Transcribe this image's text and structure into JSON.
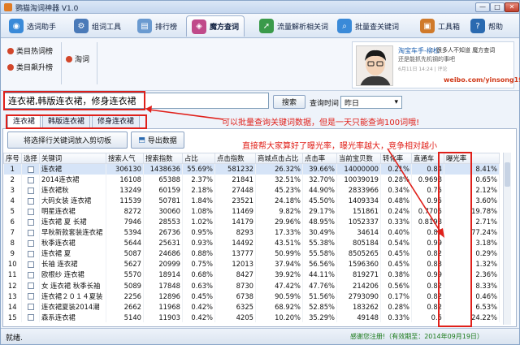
{
  "window": {
    "title": "鹦猫淘词神器 V1.0",
    "min": "—",
    "max": "□",
    "close": "✕"
  },
  "toolbar": [
    {
      "label": "选词助手",
      "icon": "globe-icon",
      "color": "#3a8ad8",
      "glyph": "◉"
    },
    {
      "label": "组词工具",
      "icon": "gear-icon",
      "color": "#4a7ab8",
      "glyph": "⚙"
    },
    {
      "label": "排行榜",
      "icon": "chart-icon",
      "color": "#6a9ad0",
      "glyph": "▤"
    },
    {
      "label": "魔方查词",
      "icon": "cube-icon",
      "color": "#c04a8a",
      "glyph": "◈"
    },
    {
      "label": "流量解析相关词",
      "icon": "flow-icon",
      "color": "#3a9a4a",
      "glyph": "➚"
    },
    {
      "label": "批量查关键词",
      "icon": "search-icon",
      "color": "#3a8ad8",
      "glyph": "⌕"
    },
    {
      "label": "工具箱",
      "icon": "toolbox-icon",
      "color": "#d07a2a",
      "glyph": "▣"
    },
    {
      "label": "帮助",
      "icon": "help-icon",
      "color": "#2a6ab0",
      "glyph": "?"
    }
  ],
  "categories": {
    "hot": "类目热词榜",
    "rising": "类目飙升榜",
    "taoci": "淘词"
  },
  "profile": {
    "name": "淘宝车手-柳松",
    "quote1": "：很多人不知道 魔方查词",
    "quote2": "还是能抓先机钢的事吧",
    "time": "6月11日 14:24  | 评论",
    "url": "weibo.com/yinsong1986"
  },
  "search": {
    "query": "连衣裙,韩版连衣裙，修身连衣裙",
    "button": "搜索",
    "time_label": "查询时间",
    "time_value": "昨日"
  },
  "tabs": [
    "连衣裙",
    "韩版连衣裙",
    "修身连衣裙"
  ],
  "actions": {
    "cut": "将选择行关键词放入剪切板",
    "export": "导出数据"
  },
  "annotations": {
    "a1": "可以批量查询关键词数据，但是一天只能查询100词哦!",
    "a2": "直接帮大家算好了曝光率，曝光率越大，竞争相对越小"
  },
  "table": {
    "headers": [
      "序号",
      "选择",
      "关键词",
      "搜索人气",
      "搜索指数",
      "占比",
      "点击指数",
      "商城点击占比",
      "点击率",
      "当前宝贝数",
      "转化率",
      "直通车",
      "曝光率"
    ],
    "rows": [
      [
        "1",
        "",
        "连衣裙",
        "306130",
        "1438636",
        "55.69%",
        "581232",
        "26.32%",
        "39.66%",
        "14000000",
        "0.21%",
        "0.84",
        "8.41%"
      ],
      [
        "2",
        "",
        "2014连衣裙",
        "16108",
        "65388",
        "2.37%",
        "21841",
        "32.51%",
        "32.70%",
        "10039019",
        "0.28%",
        "0.9698",
        "0.65%"
      ],
      [
        "3",
        "",
        "连衣裙秋",
        "13249",
        "60159",
        "2.18%",
        "27448",
        "45.23%",
        "44.90%",
        "2833966",
        "0.34%",
        "0.75",
        "2.12%"
      ],
      [
        "4",
        "",
        "大码女装 连衣裙",
        "11539",
        "50781",
        "1.84%",
        "23521",
        "24.18%",
        "45.50%",
        "1409334",
        "0.48%",
        "0.95",
        "3.60%"
      ],
      [
        "5",
        "",
        "明星连衣裙",
        "8272",
        "30060",
        "1.08%",
        "11469",
        "9.82%",
        "29.17%",
        "151861",
        "0.24%",
        "0.7705",
        "19.78%"
      ],
      [
        "6",
        "",
        "连衣裙 夏 长裙",
        "7946",
        "28553",
        "1.02%",
        "14179",
        "29.96%",
        "48.95%",
        "1052337",
        "0.33%",
        "0.8198",
        "2.71%"
      ],
      [
        "7",
        "",
        "早秋新款套装连衣裙",
        "5394",
        "26736",
        "0.95%",
        "8293",
        "17.33%",
        "30.49%",
        "34614",
        "0.40%",
        "0.89",
        "77.24%"
      ],
      [
        "8",
        "",
        "秋季连衣裙",
        "5644",
        "25631",
        "0.93%",
        "14492",
        "43.51%",
        "55.38%",
        "805184",
        "0.54%",
        "0.99",
        "3.18%"
      ],
      [
        "9",
        "",
        "连衣裙 夏",
        "5087",
        "24686",
        "0.88%",
        "13777",
        "50.99%",
        "55.58%",
        "8505265",
        "0.45%",
        "0.82",
        "0.29%"
      ],
      [
        "10",
        "",
        "长袖 连衣裙",
        "5627",
        "20999",
        "0.75%",
        "12013",
        "37.94%",
        "56.56%",
        "1596360",
        "0.45%",
        "0.83",
        "1.32%"
      ],
      [
        "11",
        "",
        "欧根纱 连衣裙",
        "5570",
        "18914",
        "0.68%",
        "8427",
        "39.92%",
        "44.11%",
        "819271",
        "0.38%",
        "0.99",
        "2.36%"
      ],
      [
        "12",
        "",
        "女 连衣裙 秋季长袖",
        "5089",
        "17848",
        "0.63%",
        "8730",
        "47.42%",
        "47.76%",
        "214206",
        "0.56%",
        "0.82",
        "8.33%"
      ],
      [
        "13",
        "",
        "连衣裙２０１４夏装",
        "2256",
        "12896",
        "0.45%",
        "6738",
        "90.59%",
        "51.56%",
        "2793090",
        "0.17%",
        "0.82",
        "0.46%"
      ],
      [
        "14",
        "",
        "连衣裙夏装2014潮",
        "2662",
        "11968",
        "0.42%",
        "6325",
        "68.92%",
        "52.85%",
        "183262",
        "0.28%",
        "0.82",
        "6.53%"
      ],
      [
        "15",
        "",
        "森系连衣裙",
        "5140",
        "11903",
        "0.42%",
        "4205",
        "10.20%",
        "35.29%",
        "49148",
        "0.33%",
        "0.5",
        "24.22%"
      ]
    ]
  },
  "status": {
    "left": "就绪.",
    "right": "感谢您注册!（有效期至：2014年09月19日）"
  }
}
